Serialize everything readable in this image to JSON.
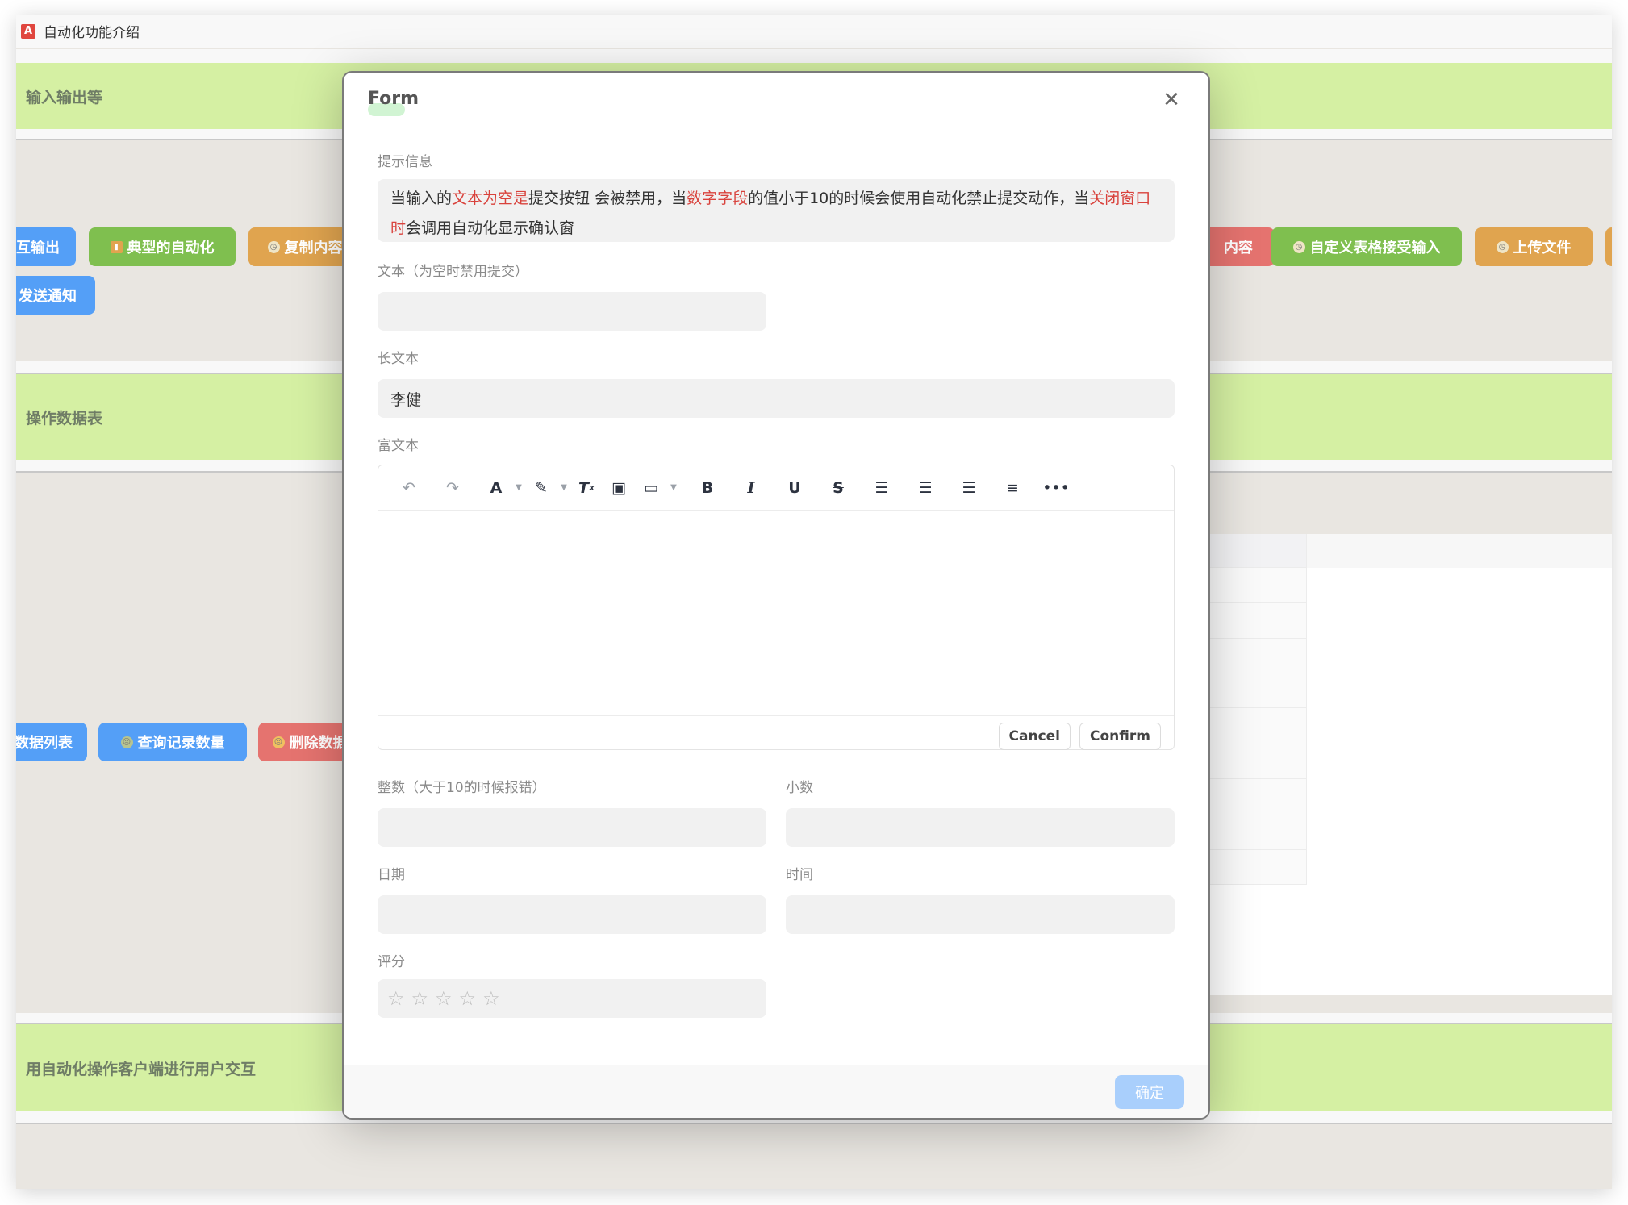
{
  "app": {
    "logo": "A",
    "title": "自动化功能介绍"
  },
  "background": {
    "sections": [
      {
        "label": "输入输出等"
      },
      {
        "label": "操作数据表"
      },
      {
        "label": "用自动化操作客户端进行用户交互"
      }
    ],
    "buttons_row1": [
      {
        "label": "互输出",
        "color": "#549ff7",
        "icon": ""
      },
      {
        "label": "典型的自动化",
        "color": "#7fbf4f",
        "icon": "chart-icon"
      },
      {
        "label": "复制内容",
        "color": "#e0a44f",
        "icon": "clock-icon"
      },
      {
        "label": "内容",
        "color": "#e5736f",
        "icon": ""
      },
      {
        "label": "自定义表格接受输入",
        "color": "#7fbf4f",
        "icon": "clock-icon"
      },
      {
        "label": "上传文件",
        "color": "#e0a44f",
        "icon": "clock-icon"
      }
    ],
    "buttons_row2": [
      {
        "label": "发送通知",
        "color": "#549ff7",
        "icon": ""
      }
    ],
    "buttons_row3": [
      {
        "label": "数据列表",
        "color": "#549ff7",
        "icon": ""
      },
      {
        "label": "查询记录数量",
        "color": "#549ff7",
        "icon": "face-icon"
      },
      {
        "label": "删除数据",
        "color": "#e5736f",
        "icon": "face-icon"
      }
    ]
  },
  "dialog": {
    "title": "Form",
    "close_icon": "close-icon",
    "hint": {
      "label": "提示信息",
      "parts": [
        {
          "text": "当输入的",
          "highlight": false
        },
        {
          "text": "文本为空是",
          "highlight": true
        },
        {
          "text": "提交按钮 会被禁用，当",
          "highlight": false
        },
        {
          "text": "数字字段",
          "highlight": true
        },
        {
          "text": "的值小于10的时候会使用自动化禁止提交动作，当",
          "highlight": false
        },
        {
          "text": "关闭窗口时",
          "highlight": true
        },
        {
          "text": "会调用自动化显示确认窗",
          "highlight": false
        }
      ]
    },
    "text_field": {
      "label": "文本（为空时禁用提交）",
      "value": ""
    },
    "long_text_field": {
      "label": "长文本",
      "value": "李健"
    },
    "rich_text": {
      "label": "富文本",
      "toolbar": [
        "undo-icon",
        "redo-icon",
        "font-color-icon",
        "highlight-icon",
        "clear-format-icon",
        "image-icon",
        "embed-icon",
        "bold-icon",
        "italic-icon",
        "underline-icon",
        "strikethrough-icon",
        "align-left-icon",
        "align-center-icon",
        "align-right-icon",
        "justify-icon",
        "more-icon"
      ],
      "cancel_label": "Cancel",
      "confirm_label": "Confirm"
    },
    "integer_field": {
      "label": "整数（大于10的时候报错）",
      "value": ""
    },
    "decimal_field": {
      "label": "小数",
      "value": ""
    },
    "date_field": {
      "label": "日期",
      "value": ""
    },
    "time_field": {
      "label": "时间",
      "value": ""
    },
    "rating": {
      "label": "评分",
      "value": 0,
      "max": 5
    },
    "ok_label": "确定"
  }
}
